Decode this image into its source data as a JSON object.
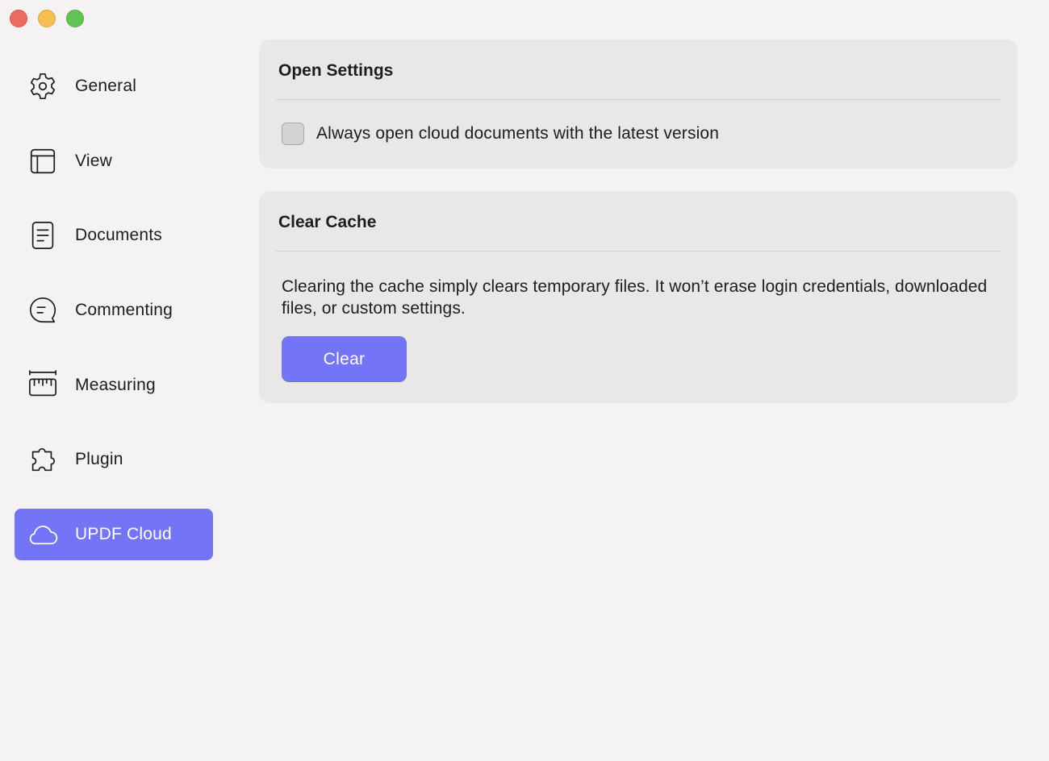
{
  "window": {
    "controls": [
      "close",
      "minimize",
      "zoom"
    ]
  },
  "sidebar": {
    "items": [
      {
        "label": "General",
        "icon": "gear-icon"
      },
      {
        "label": "View",
        "icon": "layout-icon"
      },
      {
        "label": "Documents",
        "icon": "document-icon"
      },
      {
        "label": "Commenting",
        "icon": "comment-icon"
      },
      {
        "label": "Measuring",
        "icon": "ruler-icon"
      },
      {
        "label": "Plugin",
        "icon": "puzzle-icon"
      },
      {
        "label": "UPDF Cloud",
        "icon": "cloud-icon",
        "selected": true
      }
    ]
  },
  "open_settings": {
    "title": "Open Settings",
    "checkbox_label": "Always open cloud documents with the latest version",
    "checked": false
  },
  "clear_cache": {
    "title": "Clear Cache",
    "description": "Clearing the cache simply clears temporary files. It won’t erase login credentials, downloaded files, or custom settings.",
    "button_label": "Clear"
  },
  "colors": {
    "accent": "#7474f6",
    "background": "#f4f2f3",
    "panel": "#e9e8e9"
  }
}
